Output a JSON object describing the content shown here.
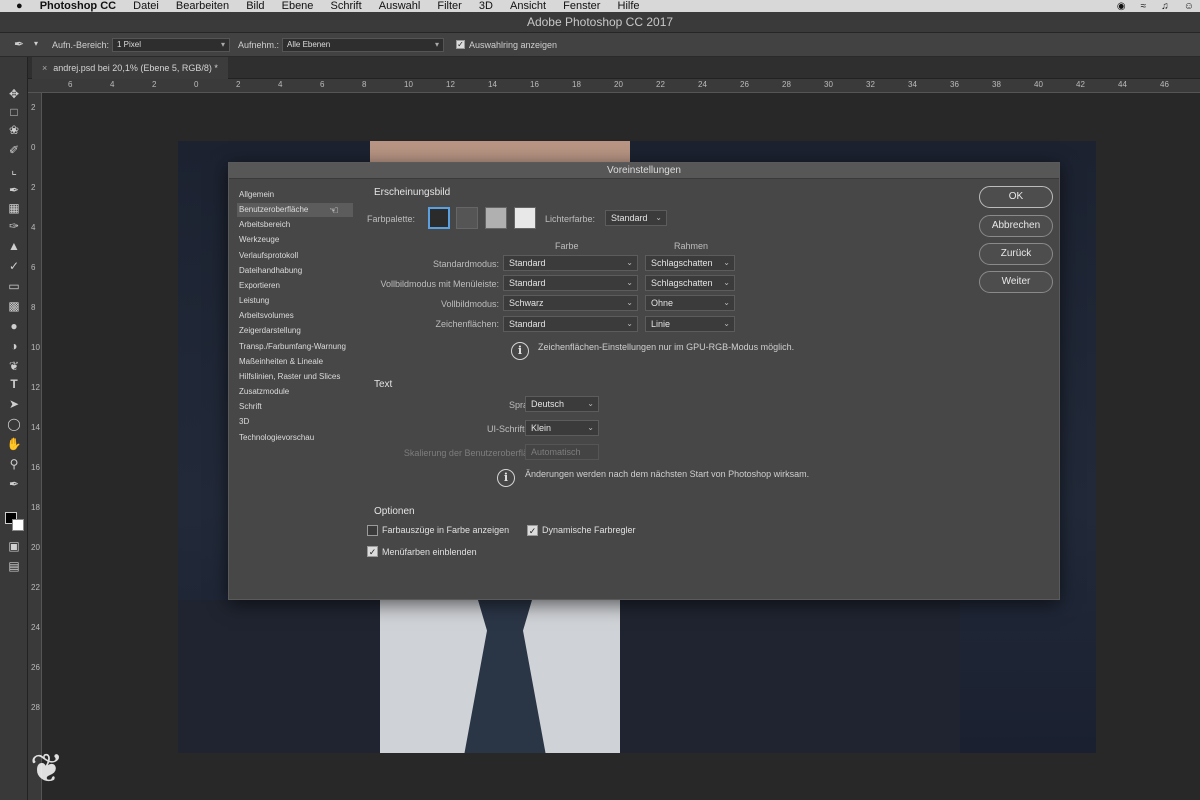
{
  "menubar": {
    "apple": "",
    "app": "Photoshop CC",
    "items": [
      "Datei",
      "Bearbeiten",
      "Bild",
      "Ebene",
      "Schrift",
      "Auswahl",
      "Filter",
      "3D",
      "Ansicht",
      "Fenster",
      "Hilfe"
    ]
  },
  "window": {
    "title": "Adobe Photoshop CC 2017"
  },
  "options": {
    "area_label": "Aufn.-Bereich:",
    "area_value": "1 Pixel",
    "sample_label": "Aufnehm.:",
    "sample_value": "Alle Ebenen",
    "ring_label": "Auswahlring anzeigen"
  },
  "document": {
    "tab_title": "andrej.psd bei 20,1% (Ebene 5, RGB/8) *"
  },
  "rulers": {
    "h": [
      "6",
      "4",
      "2",
      "0",
      "2",
      "4",
      "6",
      "8",
      "10",
      "12",
      "14",
      "16",
      "18",
      "20",
      "22",
      "24",
      "26",
      "28",
      "30",
      "32",
      "34",
      "36",
      "38",
      "40",
      "42",
      "44",
      "46"
    ],
    "v": [
      "2",
      "0",
      "2",
      "4",
      "6",
      "8",
      "10",
      "12",
      "14",
      "16",
      "18",
      "20",
      "22",
      "24",
      "26",
      "28"
    ]
  },
  "dialog": {
    "title": "Voreinstellungen",
    "nav": [
      "Allgemein",
      "Benutzeroberfläche",
      "Arbeitsbereich",
      "Werkzeuge",
      "Verlaufsprotokoll",
      "Dateihandhabung",
      "Exportieren",
      "Leistung",
      "Arbeitsvolumes",
      "Zeigerdarstellung",
      "Transp./Farbumfang-Warnung",
      "Maßeinheiten & Lineale",
      "Hilfslinien, Raster und Slices",
      "Zusatzmodule",
      "Schrift",
      "3D",
      "Technologievorschau"
    ],
    "appearance": {
      "heading": "Erscheinungsbild",
      "palette_label": "Farbpalette:",
      "swatch_colors": [
        "#2b2b2b",
        "#555555",
        "#b0b0b0",
        "#e8e8e8"
      ],
      "highlight_label": "Lichterfarbe:",
      "highlight_value": "Standard",
      "col_color": "Farbe",
      "col_frame": "Rahmen",
      "rows": [
        {
          "label": "Standardmodus:",
          "color": "Standard",
          "frame": "Schlagschatten"
        },
        {
          "label": "Vollbildmodus mit Menüleiste:",
          "color": "Standard",
          "frame": "Schlagschatten"
        },
        {
          "label": "Vollbildmodus:",
          "color": "Schwarz",
          "frame": "Ohne"
        },
        {
          "label": "Zeichenflächen:",
          "color": "Standard",
          "frame": "Linie"
        }
      ],
      "note": "Zeichenflächen-Einstellungen nur im GPU-RGB-Modus möglich."
    },
    "text": {
      "heading": "Text",
      "lang_label": "Sprache:",
      "lang_value": "Deutsch",
      "size_label": "UI-Schriftgrad:",
      "size_value": "Klein",
      "scale_label": "Skalierung der Benutzeroberfläche:",
      "scale_value": "Automatisch",
      "note": "Änderungen werden nach dem nächsten Start von Photoshop wirksam."
    },
    "options": {
      "heading": "Optionen",
      "opt1": "Farbauszüge in Farbe anzeigen",
      "opt1_checked": false,
      "opt2": "Dynamische Farbregler",
      "opt2_checked": true,
      "opt3": "Menüfarben einblenden",
      "opt3_checked": true
    },
    "buttons": {
      "ok": "OK",
      "cancel": "Abbrechen",
      "back": "Zurück",
      "next": "Weiter"
    }
  }
}
